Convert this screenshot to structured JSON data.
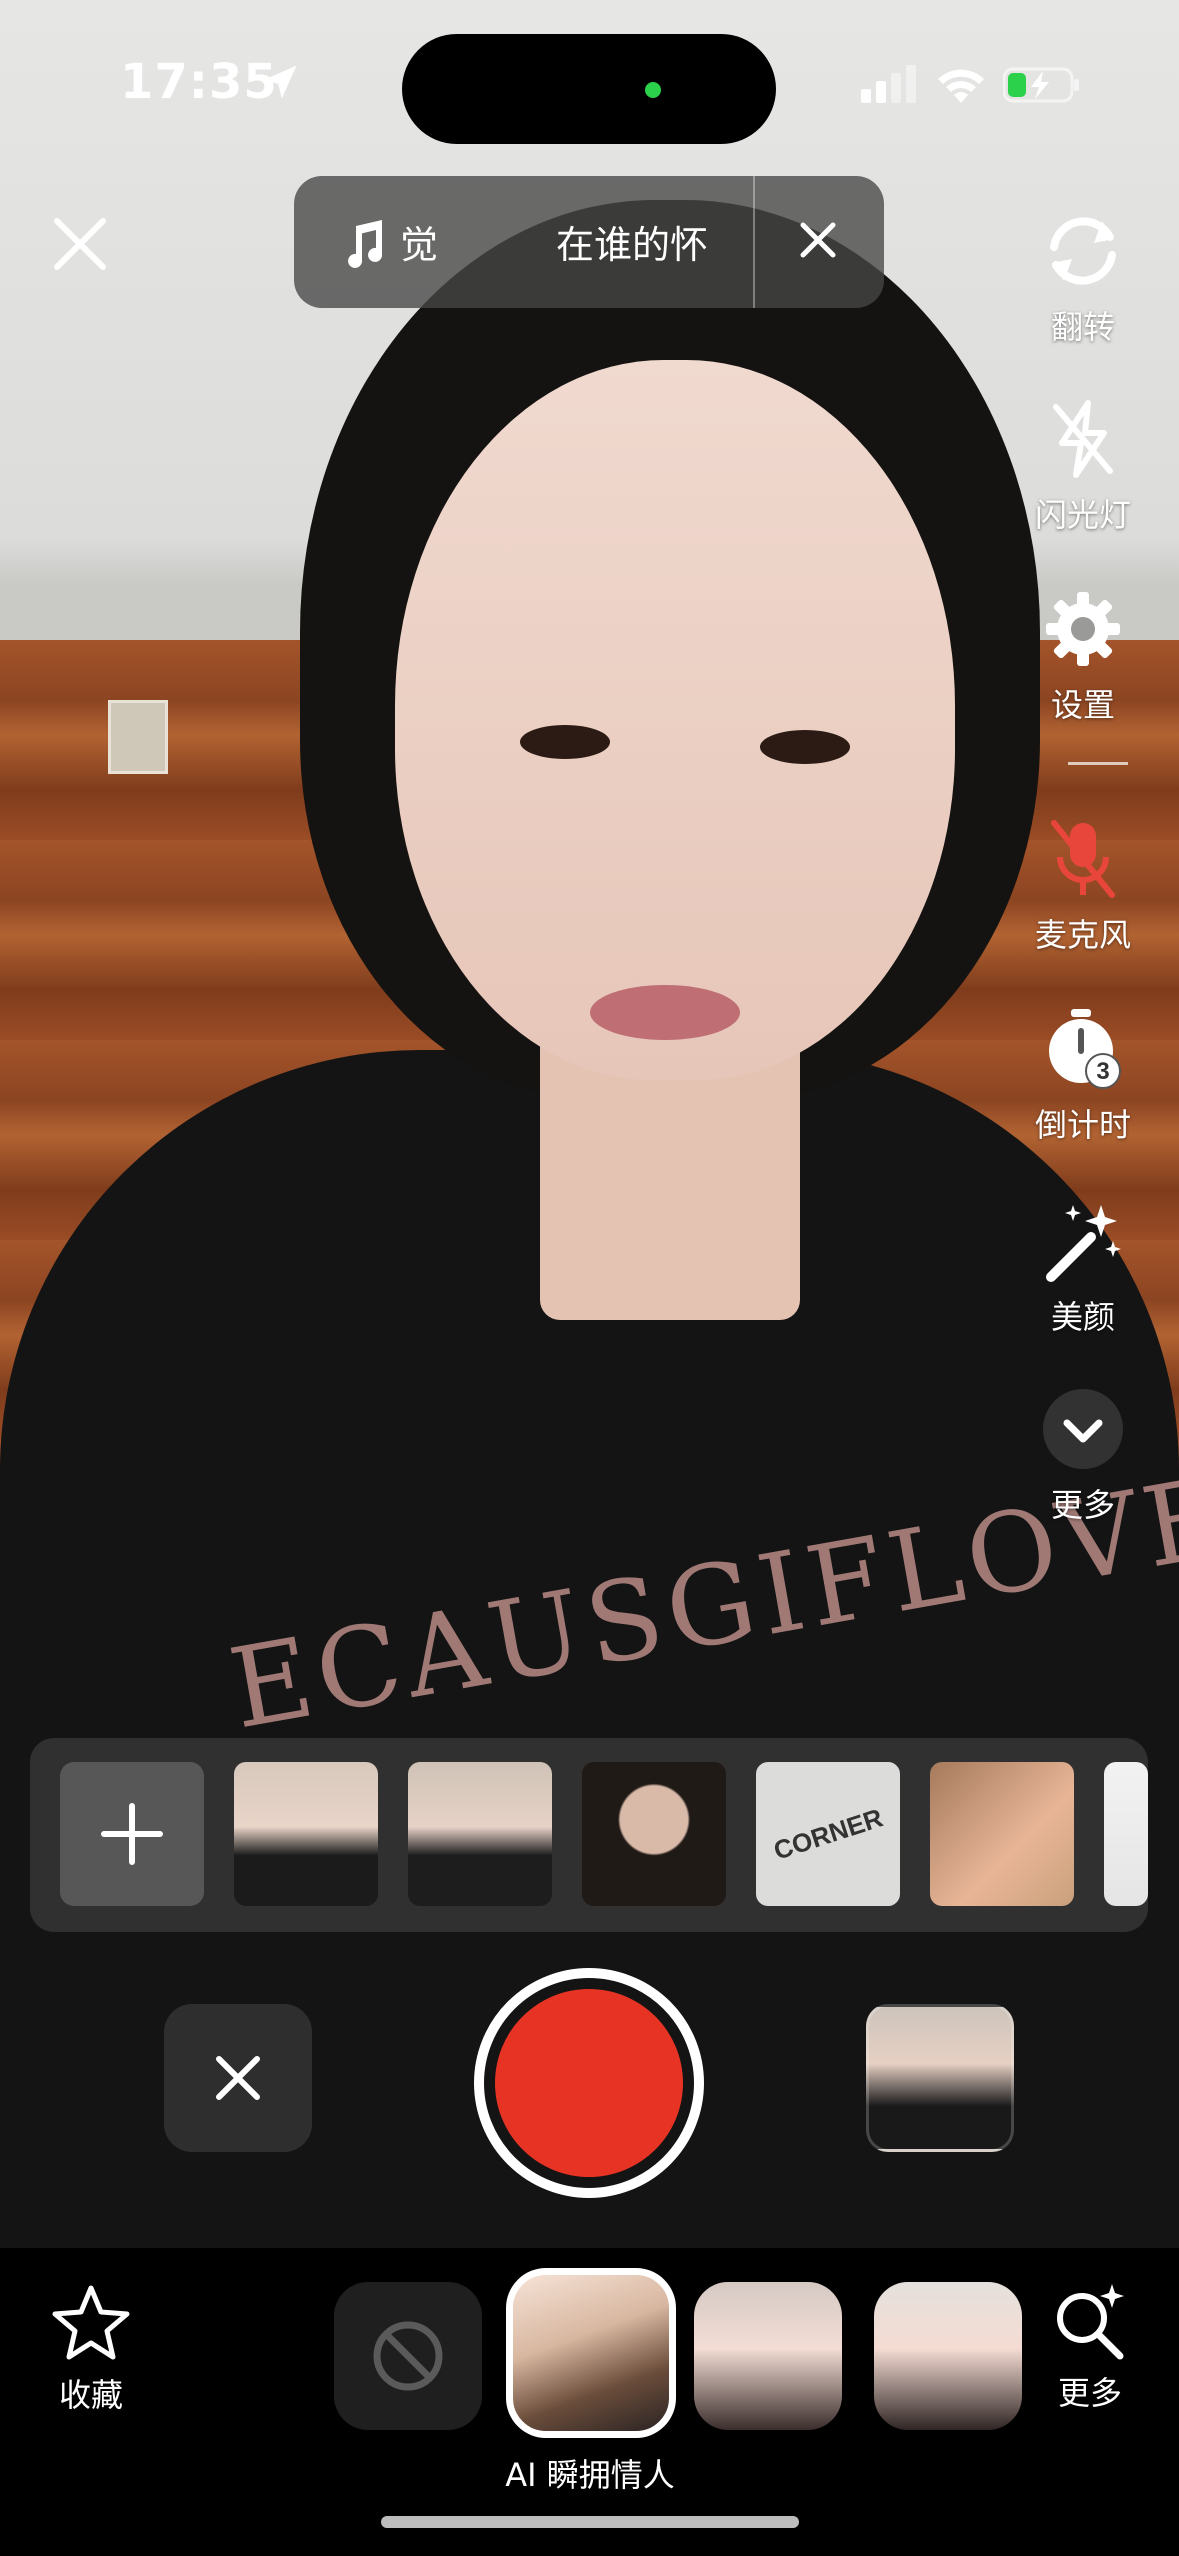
{
  "status_bar": {
    "time": "17:35"
  },
  "music": {
    "song": "觉",
    "artist": "在谁的怀"
  },
  "side_tools": [
    {
      "label": "翻转",
      "icon": "flip-camera-icon"
    },
    {
      "label": "闪光灯",
      "icon": "flash-off-icon"
    },
    {
      "label": "设置",
      "icon": "settings-gear-icon"
    },
    {
      "label": "麦克风",
      "icon": "microphone-muted-icon"
    },
    {
      "label": "倒计时",
      "icon": "countdown-timer-icon"
    },
    {
      "label": "美颜",
      "icon": "beauty-wand-icon"
    },
    {
      "label": "更多",
      "icon": "chevron-down-icon"
    }
  ],
  "timer_value": "3",
  "photo_strip": {
    "thumb_texts": [
      "",
      "",
      "",
      "CORNER",
      "",
      ""
    ]
  },
  "shirt_print": "ECAUSGIFLOVE",
  "bottom_bar": {
    "favorites_label": "收藏",
    "more_label": "更多",
    "selected_effect_name": "AI 瞬拥情人"
  },
  "colors": {
    "record": "#e73324",
    "mic_muted": "#e8463a",
    "status_green": "#2bd14b"
  }
}
